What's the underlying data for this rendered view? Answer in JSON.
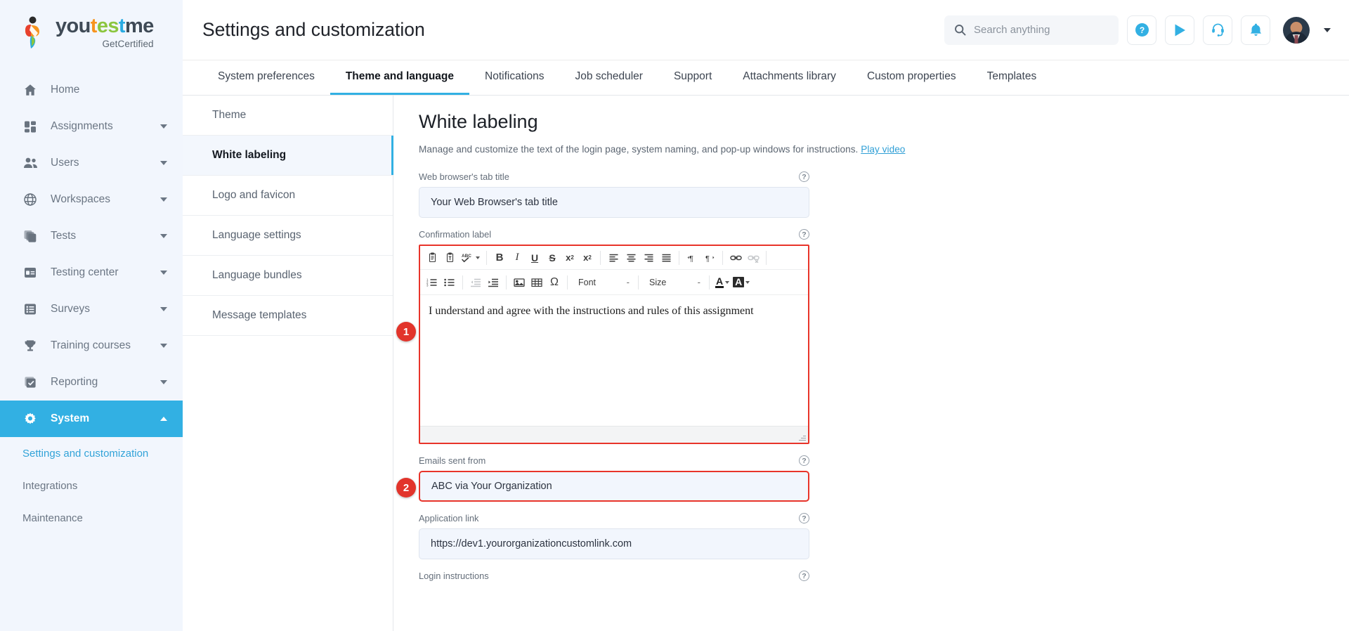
{
  "brand": {
    "name_parts": [
      "you",
      "t",
      "es",
      "t",
      "me"
    ],
    "tagline": "GetCertified"
  },
  "sidebar": {
    "items": [
      {
        "label": "Home",
        "icon": "home-icon",
        "expandable": false,
        "active": false
      },
      {
        "label": "Assignments",
        "icon": "assignments-icon",
        "expandable": true,
        "active": false
      },
      {
        "label": "Users",
        "icon": "users-icon",
        "expandable": true,
        "active": false
      },
      {
        "label": "Workspaces",
        "icon": "globe-icon",
        "expandable": true,
        "active": false
      },
      {
        "label": "Tests",
        "icon": "tests-icon",
        "expandable": true,
        "active": false
      },
      {
        "label": "Testing center",
        "icon": "testing-center-icon",
        "expandable": true,
        "active": false
      },
      {
        "label": "Surveys",
        "icon": "surveys-icon",
        "expandable": true,
        "active": false
      },
      {
        "label": "Training courses",
        "icon": "trophy-icon",
        "expandable": true,
        "active": false
      },
      {
        "label": "Reporting",
        "icon": "reporting-icon",
        "expandable": true,
        "active": false
      },
      {
        "label": "System",
        "icon": "gear-icon",
        "expandable": true,
        "active": true
      }
    ],
    "subitems": [
      {
        "label": "Settings and customization",
        "current": true
      },
      {
        "label": "Integrations",
        "current": false
      },
      {
        "label": "Maintenance",
        "current": false
      }
    ],
    "active_color": "#32b0e3",
    "link_color": "#32a3d8"
  },
  "header": {
    "title": "Settings and customization",
    "search_placeholder": "Search anything",
    "search_value": "",
    "icons": [
      "help-icon",
      "play-icon",
      "headset-icon",
      "bell-icon",
      "avatar",
      "chevron-down-icon"
    ]
  },
  "tabs": [
    {
      "label": "System preferences",
      "active": false
    },
    {
      "label": "Theme and language",
      "active": true
    },
    {
      "label": "Notifications",
      "active": false
    },
    {
      "label": "Job scheduler",
      "active": false
    },
    {
      "label": "Support",
      "active": false
    },
    {
      "label": "Attachments library",
      "active": false
    },
    {
      "label": "Custom properties",
      "active": false
    },
    {
      "label": "Templates",
      "active": false
    }
  ],
  "side_list": [
    {
      "label": "Theme",
      "selected": false
    },
    {
      "label": "White labeling",
      "selected": true
    },
    {
      "label": "Logo and favicon",
      "selected": false
    },
    {
      "label": "Language settings",
      "selected": false
    },
    {
      "label": "Language bundles",
      "selected": false
    },
    {
      "label": "Message templates",
      "selected": false
    }
  ],
  "panel": {
    "title": "White labeling",
    "description": "Manage and customize the text of the login page, system naming, and pop-up windows for instructions.",
    "video_link": "Play video"
  },
  "fields": {
    "tab_title": {
      "label": "Web browser's tab title",
      "value": "Your Web Browser's tab title",
      "help": "?"
    },
    "confirmation_label": {
      "label": "Confirmation label",
      "content": "I understand and agree with the instructions and rules of this assignment",
      "help": "?",
      "badge": "1"
    },
    "emails_sent_from": {
      "label": "Emails sent from",
      "value": "ABC via Your Organization",
      "help": "?",
      "badge": "2"
    },
    "application_link": {
      "label": "Application link",
      "value": "https://dev1.yourorganizationcustomlink.com",
      "help": "?"
    },
    "login_instructions": {
      "label": "Login instructions",
      "help": "?"
    }
  },
  "editor_toolbar": {
    "row1": [
      {
        "name": "paste-icon",
        "glyph": "paste"
      },
      {
        "name": "paste-as-text-icon",
        "glyph": "paste-text"
      },
      {
        "name": "spellcheck-icon",
        "glyph": "abc",
        "caret": true
      },
      {
        "name": "bold-icon",
        "glyph": "B"
      },
      {
        "name": "italic-icon",
        "glyph": "I"
      },
      {
        "name": "underline-icon",
        "glyph": "U"
      },
      {
        "name": "strikethrough-icon",
        "glyph": "S"
      },
      {
        "name": "subscript-icon",
        "glyph": "x2sub"
      },
      {
        "name": "superscript-icon",
        "glyph": "x2sup"
      },
      {
        "name": "align-left-icon",
        "glyph": "align-left"
      },
      {
        "name": "align-center-icon",
        "glyph": "align-center"
      },
      {
        "name": "align-right-icon",
        "glyph": "align-right"
      },
      {
        "name": "align-justify-icon",
        "glyph": "align-justify"
      },
      {
        "name": "text-direction-ltr-icon",
        "glyph": "ltr"
      },
      {
        "name": "text-direction-rtl-icon",
        "glyph": "rtl"
      },
      {
        "name": "link-icon",
        "glyph": "link"
      },
      {
        "name": "unlink-icon",
        "glyph": "unlink",
        "disabled": true
      }
    ],
    "row2": [
      {
        "name": "numbered-list-icon",
        "glyph": "ol"
      },
      {
        "name": "bulleted-list-icon",
        "glyph": "ul"
      },
      {
        "name": "decrease-indent-icon",
        "glyph": "outdent",
        "disabled": true
      },
      {
        "name": "increase-indent-icon",
        "glyph": "indent"
      },
      {
        "name": "image-icon",
        "glyph": "image"
      },
      {
        "name": "table-icon",
        "glyph": "table"
      },
      {
        "name": "special-character-icon",
        "glyph": "Ω"
      }
    ],
    "font_select": {
      "label": "Font",
      "caret": "-"
    },
    "size_select": {
      "label": "Size",
      "caret": "-"
    },
    "text_color": {
      "name": "text-color-icon",
      "glyph": "A"
    },
    "background_color": {
      "name": "background-color-icon",
      "glyph": "A"
    }
  },
  "colors": {
    "accent": "#32b0e3",
    "highlight": "#e8342a",
    "badge": "#e2342b",
    "sidebar_bg": "#f2f6fd",
    "input_bg": "#f2f6fd"
  }
}
